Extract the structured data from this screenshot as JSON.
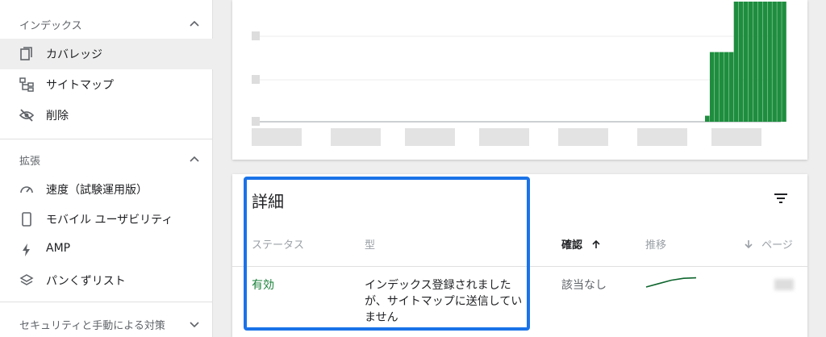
{
  "sidebar": {
    "sections": [
      {
        "header": "インデックス",
        "items": [
          {
            "label": "カバレッジ",
            "icon": "coverage-icon",
            "active": true
          },
          {
            "label": "サイトマップ",
            "icon": "sitemap-icon",
            "active": false
          },
          {
            "label": "削除",
            "icon": "removal-icon",
            "active": false
          }
        ]
      },
      {
        "header": "拡張",
        "items": [
          {
            "label": "速度（試験運用版）",
            "icon": "speed-icon",
            "active": false
          },
          {
            "label": "モバイル ユーザビリティ",
            "icon": "mobile-icon",
            "active": false
          },
          {
            "label": "AMP",
            "icon": "amp-icon",
            "active": false
          },
          {
            "label": "パンくずリスト",
            "icon": "breadcrumb-icon",
            "active": false
          }
        ]
      },
      {
        "header": "セキュリティと手動による対策",
        "items": []
      }
    ]
  },
  "chart_data": {
    "type": "bar",
    "title": "",
    "xlabel": "",
    "ylabel": "",
    "bar_color": "#1e8e3e",
    "values": [
      0.05,
      0.58,
      0.58,
      0.58,
      0.58,
      0.58,
      1.0,
      1.0,
      1.0,
      1.0,
      1.0,
      1.0,
      1.0,
      1.0,
      1.0,
      1.0,
      1.0
    ],
    "note_hidden": "axis and tick labels are blurred in the screenshot"
  },
  "details": {
    "title": "詳細",
    "columns": {
      "status": "ステータス",
      "type": "型",
      "validation": "確認",
      "validation_sort_icon": "arrow-up-icon",
      "trend": "推移",
      "pages": "ページ",
      "pages_sort_icon": "arrow-down-icon"
    },
    "rows": [
      {
        "status": "有効",
        "type_line1": "インデックス登録されました",
        "type_line2": "が、サイトマップに送信してい",
        "type_line3": "ません",
        "validation": "該当なし",
        "trend_points": [
          0.0,
          0.35,
          0.7,
          0.9,
          0.95
        ]
      }
    ]
  },
  "colors": {
    "accent_blue": "#1a73e8",
    "status_green": "#188038",
    "bar_green": "#1e8e3e"
  }
}
